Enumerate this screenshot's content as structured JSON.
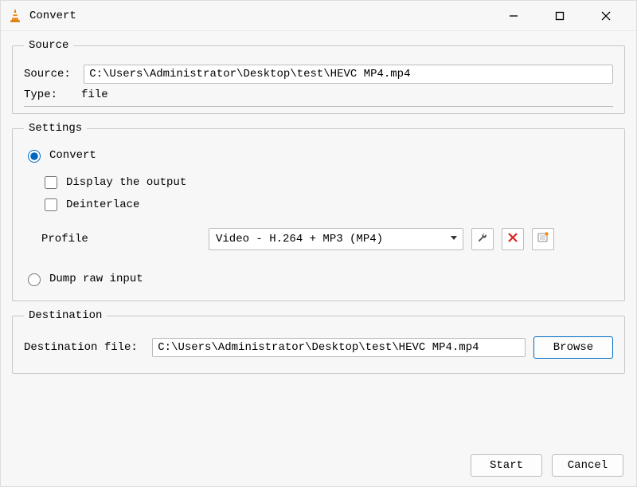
{
  "window": {
    "title": "Convert"
  },
  "source": {
    "legend": "Source",
    "source_label": "Source: ",
    "source_value": "C:\\Users\\Administrator\\Desktop\\test\\HEVC MP4.mp4",
    "type_label": "Type: ",
    "type_value": "file"
  },
  "settings": {
    "legend": "Settings",
    "convert_label": "Convert",
    "display_output_label": "Display the output",
    "deinterlace_label": "Deinterlace",
    "profile_label": "Profile",
    "profile_value": "Video - H.264 + MP3 (MP4)",
    "dump_raw_label": "Dump raw input"
  },
  "destination": {
    "legend": "Destination",
    "file_label": "Destination file: ",
    "file_value": "C:\\Users\\Administrator\\Desktop\\test\\HEVC MP4.mp4",
    "browse_label": "Browse"
  },
  "footer": {
    "start_label": "Start",
    "cancel_label": "Cancel"
  }
}
